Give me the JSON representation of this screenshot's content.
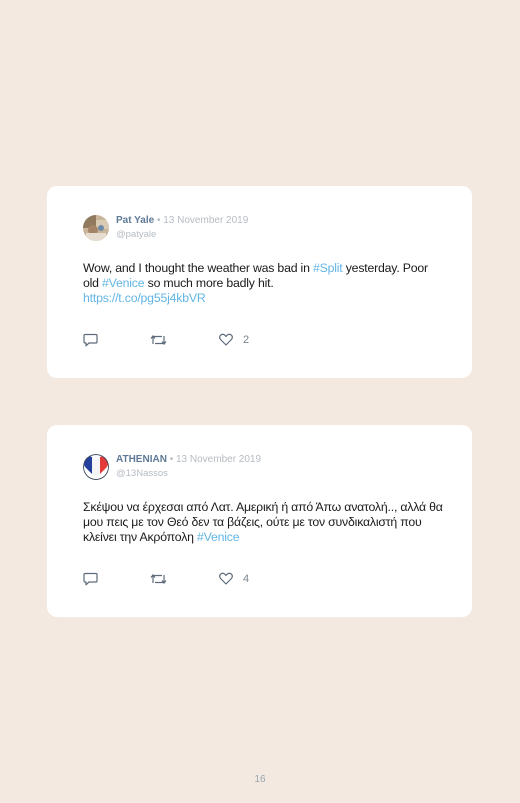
{
  "tweets": [
    {
      "name": "Pat Yale",
      "date": "13 November 2019",
      "handle": "@patyale",
      "segments": [
        {
          "text": "Wow, and I thought the weather was bad in ",
          "link": false
        },
        {
          "text": "#Split",
          "link": true
        },
        {
          "text": " yesterday. Poor old ",
          "link": false
        },
        {
          "text": "#Venice",
          "link": true
        },
        {
          "text": " so much more badly hit.",
          "link": false
        },
        {
          "text": "https://t.co/pg55j4kbVR",
          "link": true,
          "block": true
        }
      ],
      "likes": "2",
      "avatar": "photo-avatar"
    },
    {
      "name": "ATHENIAN",
      "date": "13 November 2019",
      "handle": "@13Nassos",
      "segments": [
        {
          "text": "Σκέψου να έρχεσαι από Λατ. Αμερική ή από Άπω ανατολή.., αλλά θα μου πεις με τον Θεό δεν τα βάζεις, ούτε με τον συνδικαλιστή που κλείνει την Ακρόπολη ",
          "link": false
        },
        {
          "text": "#Venice",
          "link": true
        }
      ],
      "likes": "4",
      "avatar": "flag-heart-avatar"
    }
  ],
  "separator": "•",
  "page_number": "16",
  "colors": {
    "background": "#f3e9e1",
    "card": "#ffffff",
    "link": "#62b5e5",
    "name": "#5f7a96",
    "meta": "#b5bcc3",
    "icon": "#5d6b7a"
  },
  "icons": [
    "reply-icon",
    "retweet-icon",
    "like-icon"
  ]
}
